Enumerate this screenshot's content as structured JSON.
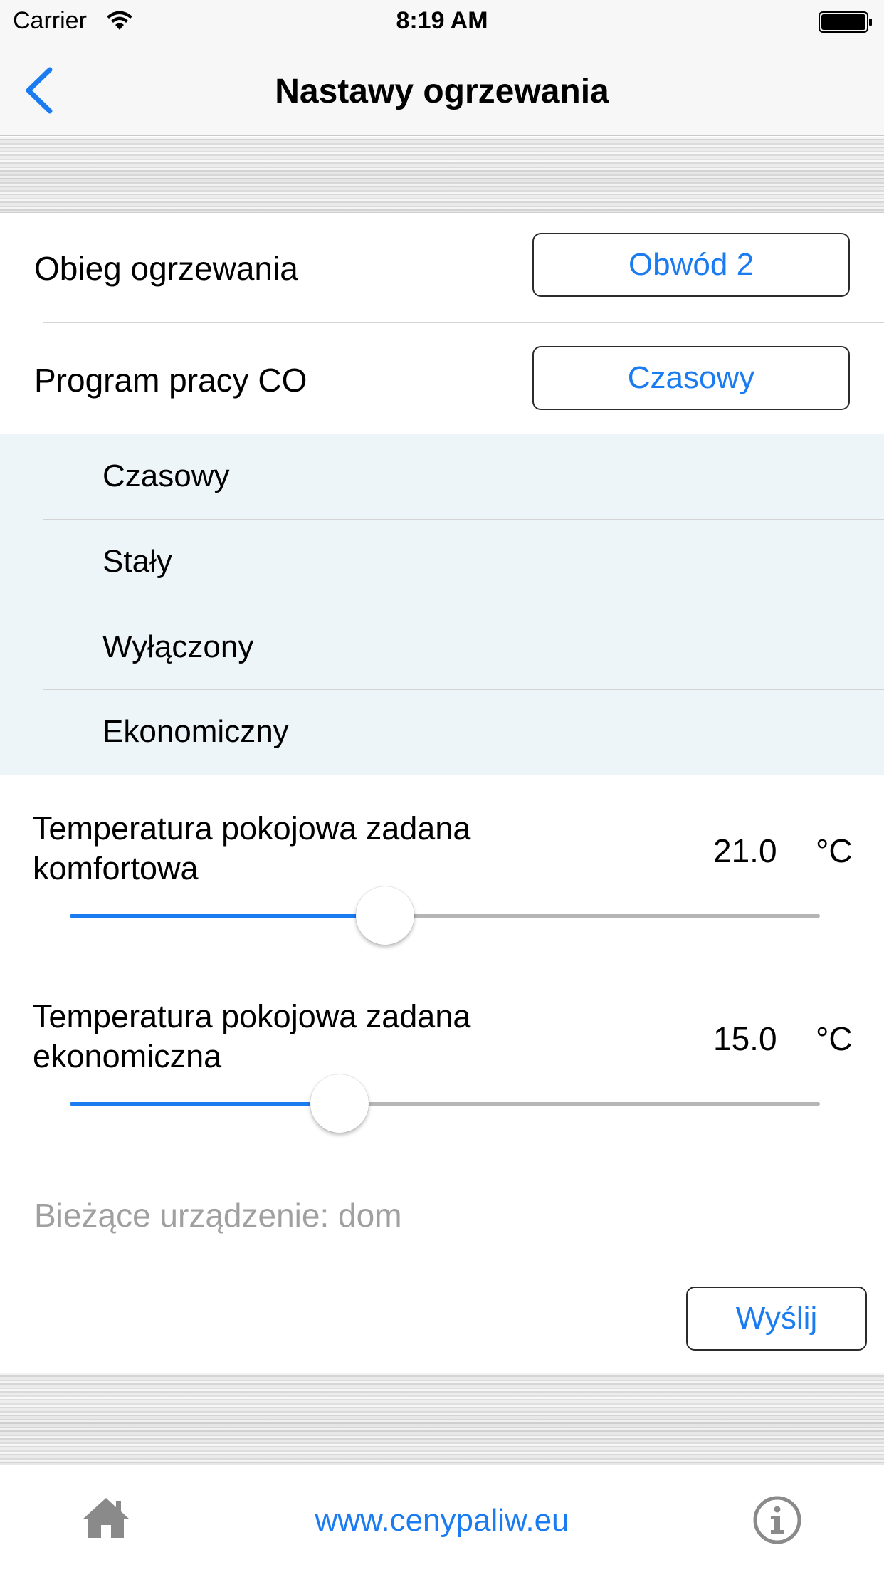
{
  "status_bar": {
    "carrier": "Carrier",
    "time": "8:19 AM",
    "wifi_icon": "wifi-icon",
    "battery_icon": "battery-icon"
  },
  "nav": {
    "title": "Nastawy ogrzewania",
    "back_icon": "chevron-left-icon"
  },
  "heating_circuit": {
    "label": "Obieg ogrzewania",
    "value": "Obwód 2"
  },
  "program": {
    "label": "Program pracy CO",
    "value": "Czasowy",
    "options": [
      "Czasowy",
      "Stały",
      "Wyłączony",
      "Ekonomiczny"
    ]
  },
  "comfort_temp": {
    "label": "Temperatura pokojowa zadana komfortowa",
    "value": "21.0",
    "unit": "°C",
    "slider_fraction": 0.42
  },
  "economy_temp": {
    "label": "Temperatura pokojowa zadana ekonomiczna",
    "value": "15.0",
    "unit": "°C",
    "slider_fraction": 0.36
  },
  "device": {
    "text": "Bieżące urządzenie: dom"
  },
  "send_label": "Wyślij",
  "footer": {
    "link": "www.cenypaliw.eu",
    "home_icon": "home-icon",
    "info_icon": "info-icon"
  },
  "colors": {
    "accent": "#1a7cf0",
    "dropdown_bg": "#eef5f8",
    "muted_text": "#a0a0a0"
  }
}
